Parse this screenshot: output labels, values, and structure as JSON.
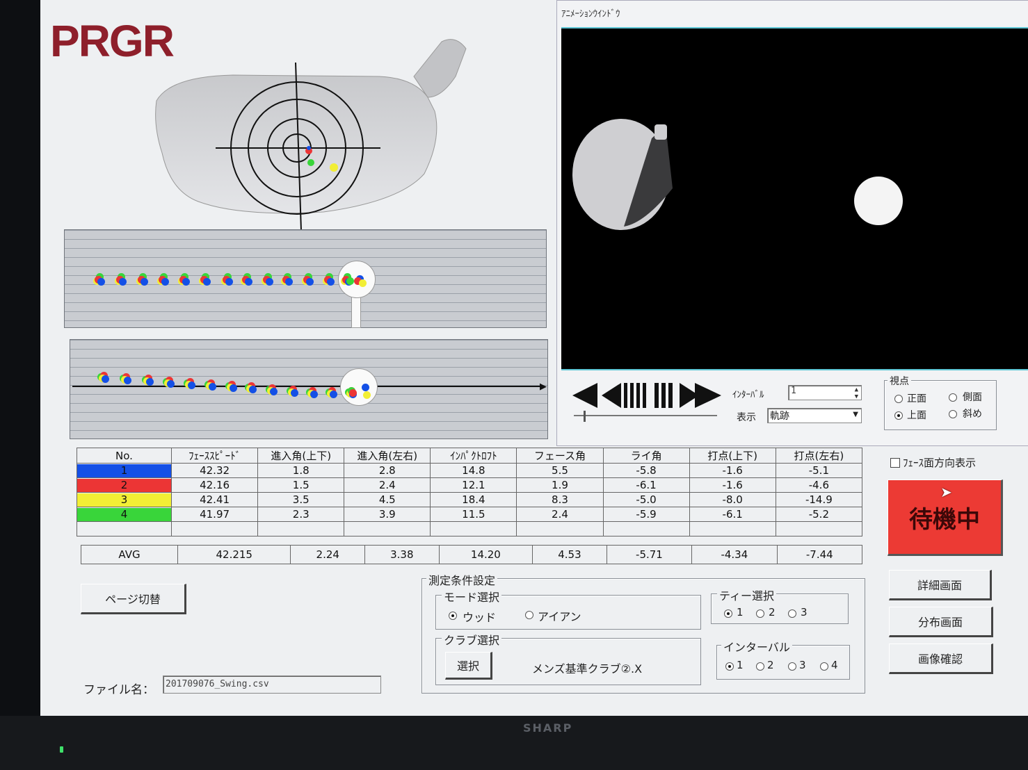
{
  "logo": "PRGR",
  "animation": {
    "title": "ｱﾆﾒｰｼｮﾝｳｲﾝﾄﾞｳ",
    "interval_label": "ｲﾝﾀｰﾊﾞﾙ",
    "interval_value": "1",
    "display_label": "表示",
    "display_value": "軌跡",
    "viewpoint": {
      "title": "視点",
      "options": [
        "正面",
        "側面",
        "上面",
        "斜め"
      ],
      "selected": "上面"
    }
  },
  "table": {
    "headers": [
      "No.",
      "ﾌｪｰｽｽﾋﾟｰﾄﾞ",
      "進入角(上下)",
      "進入角(左右)",
      "ｲﾝﾊﾟｸﾄﾛﾌﾄ",
      "フェース角",
      "ライ角",
      "打点(上下)",
      "打点(左右)"
    ],
    "rows": [
      {
        "no": "1",
        "color": "#1450e6",
        "values": [
          "42.32",
          "1.8",
          "2.8",
          "14.8",
          "5.5",
          "-5.8",
          "-1.6",
          "-5.1"
        ]
      },
      {
        "no": "2",
        "color": "#ec3535",
        "values": [
          "42.16",
          "1.5",
          "2.4",
          "12.1",
          "1.9",
          "-6.1",
          "-1.6",
          "-4.6"
        ]
      },
      {
        "no": "3",
        "color": "#f2ee35",
        "values": [
          "42.41",
          "3.5",
          "4.5",
          "18.4",
          "8.3",
          "-5.0",
          "-8.0",
          "-14.9"
        ]
      },
      {
        "no": "4",
        "color": "#39d53a",
        "values": [
          "41.97",
          "2.3",
          "3.9",
          "11.5",
          "2.4",
          "-5.9",
          "-6.1",
          "-5.2"
        ]
      }
    ],
    "avg_label": "AVG",
    "avg": [
      "42.215",
      "2.24",
      "3.38",
      "14.20",
      "4.53",
      "-5.71",
      "-4.34",
      "-7.44"
    ]
  },
  "face_direction_label": "ﾌｪｰｽ面方向表示",
  "status": "待機中",
  "buttons": {
    "page_switch": "ページ切替",
    "detail": "詳細画面",
    "distribution": "分布画面",
    "image_check": "画像確認",
    "select": "選択"
  },
  "settings": {
    "title": "測定条件設定",
    "mode_title": "モード選択",
    "mode_options": [
      "ウッド",
      "アイアン"
    ],
    "mode_selected": "ウッド",
    "club_title": "クラブ選択",
    "club_name": "メンズ基準クラブ②.X",
    "tee_title": "ティー選択",
    "tee_options": [
      "1",
      "2",
      "3"
    ],
    "tee_selected": "1",
    "interval_title": "インターバル",
    "interval_options": [
      "1",
      "2",
      "3",
      "4"
    ],
    "interval_selected": "1"
  },
  "file": {
    "label": "ファイル名：",
    "value": "201709076_Swing.csv"
  },
  "monitor_brand": "SHARP",
  "colors": {
    "blue": "#1450e6",
    "red": "#ec3535",
    "yellow": "#f2ee35",
    "green": "#39d53a",
    "standby": "#ec3a34"
  }
}
